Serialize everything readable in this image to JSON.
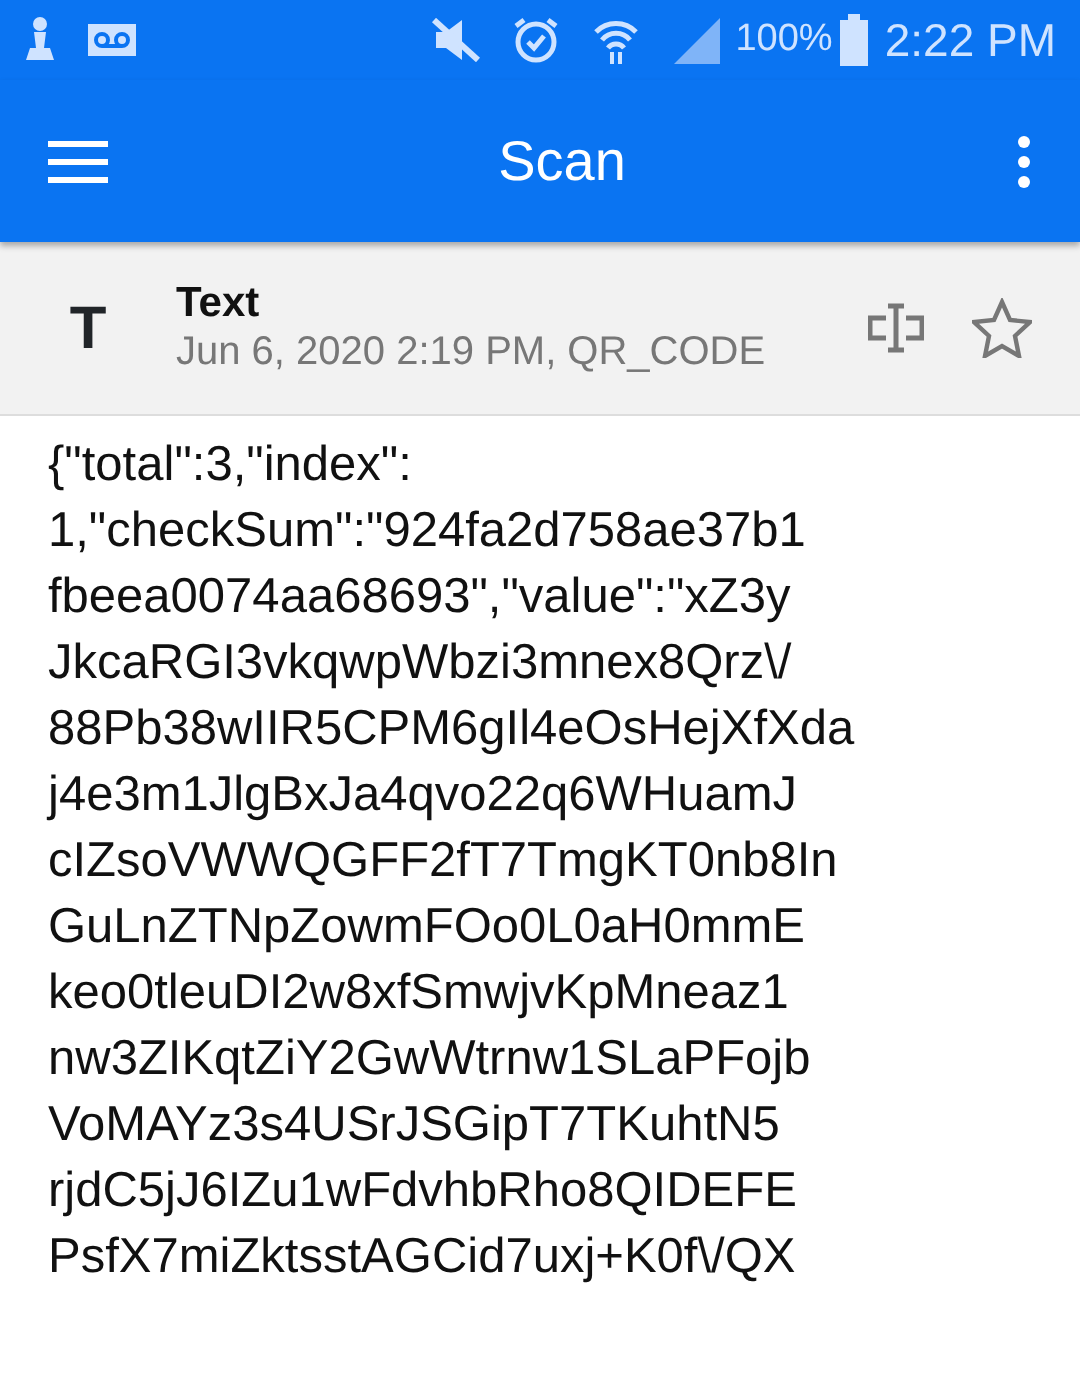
{
  "status_bar": {
    "battery_text": "100%",
    "time": "2:22 PM"
  },
  "app_bar": {
    "title": "Scan"
  },
  "scan_header": {
    "type_letter": "T",
    "title": "Text",
    "subtitle": "Jun 6, 2020 2:19 PM, QR_CODE",
    "starred": false
  },
  "content_lines": [
    "{\"total\":3,\"index\":",
    "1,\"checkSum\":\"924fa2d758ae37b1",
    "fbeea0074aa68693\",\"value\":\"xZ3y",
    "JkcaRGI3vkqwpWbzi3mnex8Qrz\\/",
    "88Pb38wIIR5CPM6gIl4eOsHejXfXda",
    "j4e3m1JlgBxJa4qvo22q6WHuamJ",
    "cIZsoVWWQGFF2fT7TmgKT0nb8In",
    "GuLnZTNpZowmFOo0L0aH0mmE",
    "keo0tleuDI2w8xfSmwjvKpMneaz1",
    "nw3ZIKqtZiY2GwWtrnw1SLaPFojb",
    "VoMAYz3s4USrJSGipT7TKuhtN5",
    "rjdC5jJ6IZu1wFdvhbRho8QIDEFE",
    "PsfX7miZktsstAGCid7uxj+K0f\\/QX"
  ]
}
